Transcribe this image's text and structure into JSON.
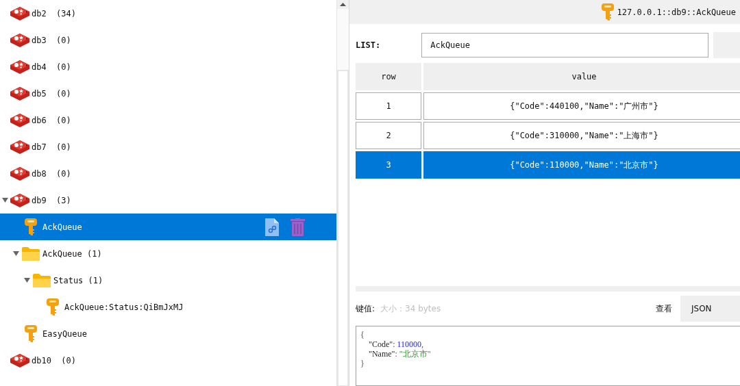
{
  "tree": [
    {
      "kind": "db",
      "label": "db2  (34)",
      "expanded": false,
      "selected": false
    },
    {
      "kind": "db",
      "label": "db3  (0)",
      "expanded": false,
      "selected": false
    },
    {
      "kind": "db",
      "label": "db4  (0)",
      "expanded": false,
      "selected": false
    },
    {
      "kind": "db",
      "label": "db5  (0)",
      "expanded": false,
      "selected": false
    },
    {
      "kind": "db",
      "label": "db6  (0)",
      "expanded": false,
      "selected": false
    },
    {
      "kind": "db",
      "label": "db7  (0)",
      "expanded": false,
      "selected": false
    },
    {
      "kind": "db",
      "label": "db8  (0)",
      "expanded": false,
      "selected": false
    },
    {
      "kind": "db",
      "label": "db9  (3)",
      "expanded": true,
      "selected": false,
      "children": [
        {
          "kind": "key",
          "label": "AckQueue",
          "selected": true
        },
        {
          "kind": "folder",
          "label": "AckQueue (1)",
          "expanded": true,
          "selected": false,
          "children": [
            {
              "kind": "folder",
              "label": "Status (1)",
              "expanded": true,
              "selected": false,
              "children": [
                {
                  "kind": "key",
                  "label": "AckQueue:Status:QiBmJxMJ",
                  "selected": false
                }
              ]
            }
          ]
        },
        {
          "kind": "key",
          "label": "EasyQueue",
          "selected": false
        }
      ]
    },
    {
      "kind": "db",
      "label": "db10  (0)",
      "expanded": false,
      "selected": false
    }
  ],
  "header": {
    "title": "127.0.0.1::db9::AckQueue"
  },
  "key_type": "LIST:",
  "key_name": "AckQueue",
  "table": {
    "columns": [
      "row",
      "value"
    ],
    "rows": [
      {
        "cells": [
          "1",
          "{\"Code\":440100,\"Name\":\"广州市\"}"
        ],
        "selected": false
      },
      {
        "cells": [
          "2",
          "{\"Code\":310000,\"Name\":\"上海市\"}"
        ],
        "selected": false
      },
      {
        "cells": [
          "3",
          "{\"Code\":110000,\"Name\":\"北京市\"}"
        ],
        "selected": true
      }
    ]
  },
  "value_label": "键值:",
  "value_size": "大小：34 bytes",
  "view_label": "查看",
  "view_mode": "JSON",
  "json_view": {
    "lines": [
      {
        "indented": false,
        "tokens": [
          {
            "kind": "punct",
            "text": "{"
          }
        ]
      },
      {
        "indented": true,
        "tokens": [
          {
            "kind": "key",
            "text": "\"Code\""
          },
          {
            "kind": "punct",
            "text": ": "
          },
          {
            "kind": "number",
            "text": "110000"
          },
          {
            "kind": "punct",
            "text": ","
          }
        ]
      },
      {
        "indented": true,
        "tokens": [
          {
            "kind": "key",
            "text": "\"Name\""
          },
          {
            "kind": "punct",
            "text": ": "
          },
          {
            "kind": "string",
            "text": "\"北京市\""
          }
        ]
      },
      {
        "indented": false,
        "tokens": [
          {
            "kind": "punct",
            "text": "}"
          }
        ]
      }
    ]
  }
}
